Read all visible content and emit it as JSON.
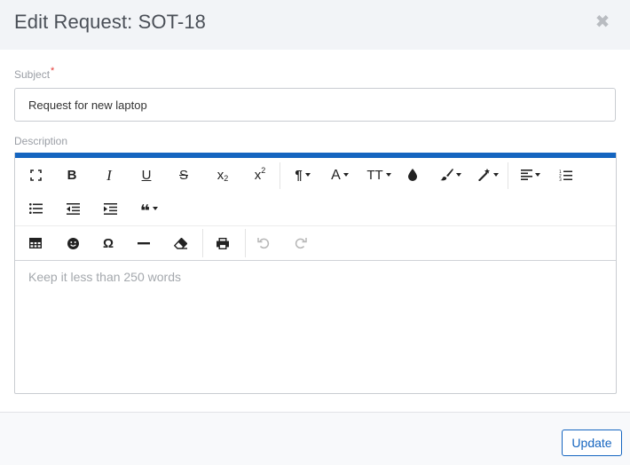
{
  "modal": {
    "title": "Edit Request: SOT-18",
    "close_icon": "close-icon",
    "close_glyph": "✖"
  },
  "form": {
    "subject": {
      "label": "Subject",
      "required_mark": "*",
      "value": "Request for new laptop"
    },
    "description": {
      "label": "Description",
      "placeholder": "Keep it less than 250 words"
    }
  },
  "toolbar": {
    "buttons": [
      {
        "name": "fullscreen-icon"
      },
      {
        "name": "bold-icon",
        "glyph": "B"
      },
      {
        "name": "italic-icon",
        "glyph": "I"
      },
      {
        "name": "underline-icon",
        "glyph": "U"
      },
      {
        "name": "strikethrough-icon",
        "glyph": "S"
      },
      {
        "name": "subscript-icon",
        "glyph": "x",
        "sub": "2"
      },
      {
        "name": "superscript-icon",
        "glyph": "x",
        "sup": "2"
      },
      {
        "name": "paragraph-format-icon",
        "glyph": "¶"
      },
      {
        "name": "font-family-icon",
        "glyph": "A"
      },
      {
        "name": "font-size-icon",
        "glyph": "TT"
      },
      {
        "name": "text-color-icon"
      },
      {
        "name": "background-color-icon"
      },
      {
        "name": "inline-style-icon"
      },
      {
        "name": "align-icon"
      },
      {
        "name": "ordered-list-icon"
      },
      {
        "name": "unordered-list-icon"
      },
      {
        "name": "outdent-icon"
      },
      {
        "name": "indent-icon"
      },
      {
        "name": "quote-icon",
        "glyph": "❝"
      },
      {
        "name": "table-icon"
      },
      {
        "name": "emoticon-icon"
      },
      {
        "name": "special-characters-icon",
        "glyph": "Ω"
      },
      {
        "name": "horizontal-line-icon"
      },
      {
        "name": "clear-formatting-icon"
      },
      {
        "name": "print-icon"
      },
      {
        "name": "undo-icon"
      },
      {
        "name": "redo-icon"
      }
    ],
    "colors": {
      "accent": "#1565c0",
      "icon": "#222222",
      "disabled": "#b7b7b7"
    }
  },
  "footer": {
    "update_label": "Update"
  },
  "colors": {
    "header_bg": "#f2f4f7",
    "footer_bg": "#f8f9fb",
    "primary": "#1565c0",
    "required": "#e53935"
  }
}
